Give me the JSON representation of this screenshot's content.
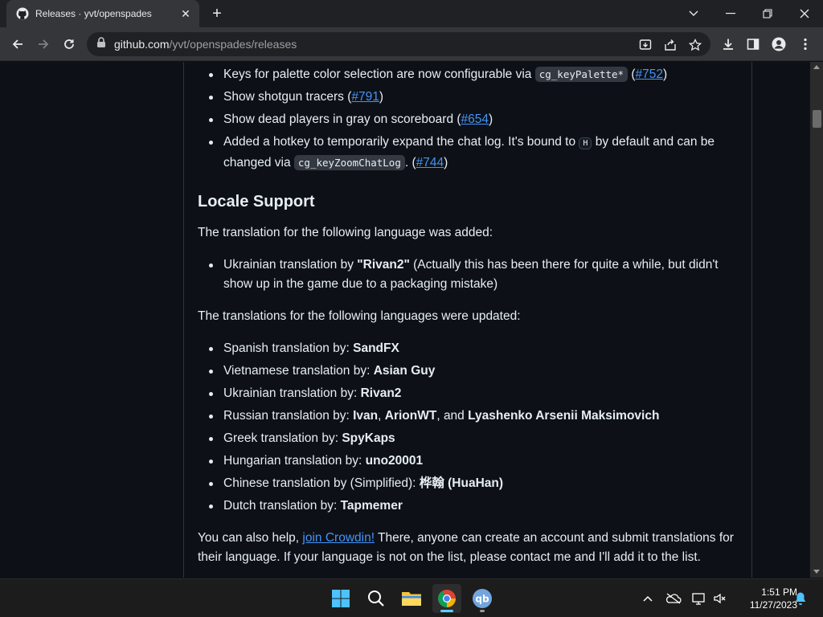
{
  "browser": {
    "tab_title": "Releases · yvt/openspades",
    "url_host": "github.com",
    "url_path": "/yvt/openspades/releases"
  },
  "release_notes": {
    "feature_items": [
      {
        "text": "Keys for palette color selection are now configurable via ",
        "code": "cg_keyPalette*",
        "pre_link": " (",
        "link": "#752",
        "post": ")"
      },
      {
        "text": "Show shotgun tracers (",
        "link": "#791",
        "post": ")"
      },
      {
        "text": "Show dead players in gray on scoreboard (",
        "link": "#654",
        "post": ")"
      },
      {
        "text": "Added a hotkey to temporarily expand the chat log. It's bound to ",
        "kbd": "H",
        "text2": " by default and can be changed via ",
        "code": "cg_keyZoomChatLog",
        "pre_link": ". (",
        "link": "#744",
        "post": ")"
      }
    ],
    "locale_heading": "Locale Support",
    "added_intro": "The translation for the following language was added:",
    "added_item": {
      "pre": "Ukrainian translation by ",
      "bold": "\"Rivan2\"",
      "post": " (Actually this has been there for quite a while, but didn't show up in the game due to a packaging mistake)"
    },
    "updated_intro": "The translations for the following languages were updated:",
    "updated_items": [
      {
        "pre": "Spanish translation by: ",
        "bold": "SandFX"
      },
      {
        "pre": "Vietnamese translation by: ",
        "bold": "Asian Guy"
      },
      {
        "pre": "Ukrainian translation by: ",
        "bold": "Rivan2"
      },
      {
        "pre": "Russian translation by: ",
        "bold": "Ivan",
        "sep1": ", ",
        "bold2": "ArionWT",
        "sep2": ", and ",
        "bold3": "Lyashenko Arsenii Maksimovich"
      },
      {
        "pre": "Greek translation by: ",
        "bold": "SpyKaps"
      },
      {
        "pre": "Hungarian translation by: ",
        "bold": "uno20001"
      },
      {
        "pre": "Chinese translation by (Simplified): ",
        "bold": "桦翰 (HuaHan)"
      },
      {
        "pre": "Dutch translation by: ",
        "bold": "Tapmemer"
      }
    ],
    "help": {
      "pre": "You can also help, ",
      "link": "join Crowdin!",
      "post": " There, anyone can create an account and submit translations for their language. If your language is not on the list, please contact me and I'll add it to the list."
    }
  },
  "taskbar": {
    "time": "1:51 PM",
    "date": "11/27/2023"
  },
  "colors": {
    "page_bg": "#0d1117",
    "text": "#e6edf3",
    "link": "#4493f8",
    "chrome_tab": "#35363a",
    "chrome_frame": "#202124",
    "taskbar": "#1c1c1c",
    "accent": "#60cdff"
  }
}
